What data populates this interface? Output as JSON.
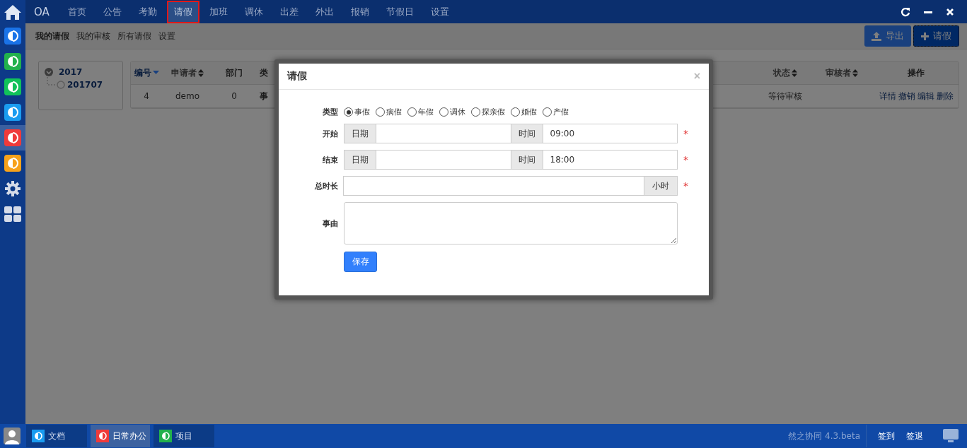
{
  "sidebar": {
    "apps": [
      {
        "kind": "app",
        "color": "#1a73e8",
        "selected": false
      },
      {
        "kind": "app",
        "color": "#22b14c",
        "selected": false
      },
      {
        "kind": "app",
        "color": "#11c25a",
        "selected": false
      },
      {
        "kind": "app",
        "color": "#1a9cf0",
        "selected": false
      },
      {
        "kind": "app",
        "color": "#f03a3a",
        "selected": true
      },
      {
        "kind": "app",
        "color": "#f7a21b",
        "selected": false
      },
      {
        "kind": "settings",
        "selected": false
      },
      {
        "kind": "grid",
        "selected": false
      }
    ]
  },
  "top_nav": {
    "brand": "OA",
    "items": [
      {
        "label": "首页",
        "selected": false
      },
      {
        "label": "公告",
        "selected": false
      },
      {
        "label": "考勤",
        "selected": false
      },
      {
        "label": "请假",
        "selected": true
      },
      {
        "label": "加班",
        "selected": false
      },
      {
        "label": "调休",
        "selected": false
      },
      {
        "label": "出差",
        "selected": false
      },
      {
        "label": "外出",
        "selected": false
      },
      {
        "label": "报销",
        "selected": false
      },
      {
        "label": "节假日",
        "selected": false
      },
      {
        "label": "设置",
        "selected": false
      }
    ]
  },
  "sub_nav": {
    "items": [
      {
        "label": "我的请假",
        "selected": true
      },
      {
        "label": "我的审核",
        "selected": false
      },
      {
        "label": "所有请假",
        "selected": false
      },
      {
        "label": "设置",
        "selected": false
      }
    ]
  },
  "toolbar_buttons": [
    {
      "kind": "export",
      "label": "导出"
    },
    {
      "kind": "add",
      "label": "请假"
    }
  ],
  "tree": {
    "label": "2017",
    "expanded": true,
    "children": [
      {
        "label": "201707"
      }
    ]
  },
  "table": {
    "columns": [
      {
        "label": "编号",
        "sortable": true,
        "sorted": true
      },
      {
        "label": "申请者",
        "sortable": true,
        "sorted": false
      },
      {
        "label": "部门",
        "sortable": false,
        "sorted": false
      },
      {
        "label": "类",
        "sortable": false,
        "sorted": false
      },
      {
        "label": "状态",
        "sortable": true,
        "sorted": false
      },
      {
        "label": "审核者",
        "sortable": true,
        "sorted": false
      },
      {
        "label": "操作",
        "sortable": false,
        "sorted": false
      }
    ],
    "rows": [
      {
        "id": "4",
        "applicant": "demo",
        "dept": "0",
        "type": "事",
        "status": "等待审核",
        "actions": [
          "详情",
          "撤销",
          "编辑",
          "删除"
        ]
      }
    ]
  },
  "dialog": {
    "title": "请假",
    "close": "×",
    "type_label": "类型",
    "types": [
      {
        "label": "事假",
        "selected": true
      },
      {
        "label": "病假",
        "selected": false
      },
      {
        "label": "年假",
        "selected": false
      },
      {
        "label": "调休",
        "selected": false
      },
      {
        "label": "探亲假",
        "selected": false
      },
      {
        "label": "婚假",
        "selected": false
      },
      {
        "label": "产假",
        "selected": false
      }
    ],
    "start": {
      "label": "开始",
      "date_addon": "日期",
      "time_addon": "时间",
      "time": "09:00",
      "required": "*"
    },
    "end": {
      "label": "结束",
      "date_addon": "日期",
      "time_addon": "时间",
      "time": "18:00",
      "required": "*"
    },
    "duration": {
      "label": "总时长",
      "unit": "小时",
      "required": "*"
    },
    "reason": {
      "label": "事由"
    },
    "save": "保存"
  },
  "taskbar": {
    "items": [
      {
        "label": "文档",
        "color": "#1a9cf0",
        "selected": false
      },
      {
        "label": "日常办公",
        "color": "#f03a3a",
        "selected": true
      },
      {
        "label": "项目",
        "color": "#22b14c",
        "selected": false
      }
    ],
    "version": "然之协同 4.3.beta",
    "buttons": [
      "签到",
      "签退"
    ]
  }
}
